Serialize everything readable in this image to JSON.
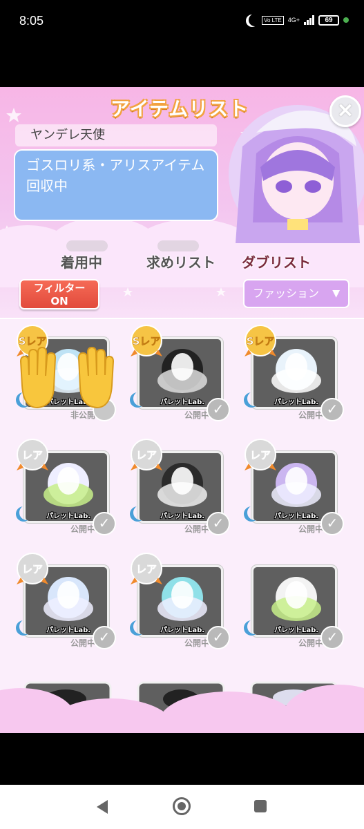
{
  "status_bar": {
    "time": "8:05",
    "network": "4G+",
    "volte": "Vo LTE",
    "battery": "69"
  },
  "header": {
    "title": "アイテムリスト",
    "close_label": "×"
  },
  "profile": {
    "username": "ヤンデレ天使",
    "comment": "ゴスロリ系・アリスアイテム回収中"
  },
  "tabs": [
    {
      "label": "着用中"
    },
    {
      "label": "求めリスト"
    },
    {
      "label": "ダブリスト"
    }
  ],
  "filter": {
    "label": "フィルター\nON"
  },
  "category_select": {
    "selected": "ファッション",
    "chevron": "▼"
  },
  "items": [
    {
      "rarity": "Sレア",
      "brand": "パレットLab.",
      "status": "非公開",
      "checked": false,
      "art": "wig-blue"
    },
    {
      "rarity": "Sレア",
      "brand": "パレットLab.",
      "status": "公開中",
      "checked": true,
      "art": "wig-black"
    },
    {
      "rarity": "Sレア",
      "brand": "パレットLab.",
      "status": "公開中",
      "checked": true,
      "art": "wig-white"
    },
    {
      "rarity": "レア",
      "brand": "パレットLab.",
      "status": "公開中",
      "checked": true,
      "art": "dress-green"
    },
    {
      "rarity": "レア",
      "brand": "パレットLab.",
      "status": "公開中",
      "checked": true,
      "art": "dress-black"
    },
    {
      "rarity": "レア",
      "brand": "パレットLab.",
      "status": "公開中",
      "checked": true,
      "art": "dress-purple"
    },
    {
      "rarity": "レア",
      "brand": "パレットLab.",
      "status": "公開中",
      "checked": true,
      "art": "dress-blue"
    },
    {
      "rarity": "レア",
      "brand": "パレットLab.",
      "status": "公開中",
      "checked": true,
      "art": "hat-teal"
    },
    {
      "rarity": "",
      "brand": "パレットLab.",
      "status": "公開中",
      "checked": true,
      "art": "ears-green"
    }
  ],
  "colors": {
    "tab_active": "#7a2c3c",
    "filter_bg": "#e24b3c",
    "select_bg": "#d8a5f0",
    "comment_bg": "#8bb8f2"
  }
}
